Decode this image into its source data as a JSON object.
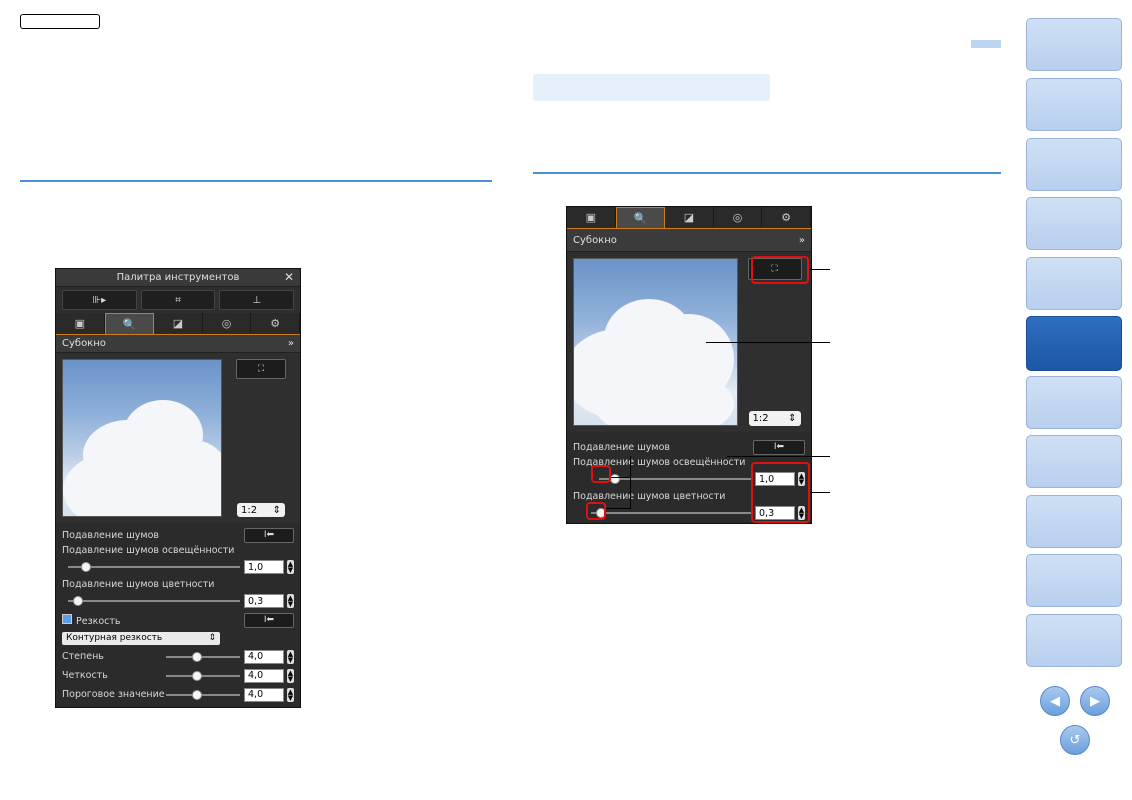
{
  "left_panel": {
    "title": "Палитра инструментов",
    "close_glyph": "✕",
    "tool_buttons": [
      "⊪▸",
      "⌗",
      "⊥"
    ],
    "tabs": [
      "▣",
      "🔍",
      "◪",
      "◎",
      "⚙"
    ],
    "section_title": "Субокно",
    "collapse_glyph": "»",
    "zoom_value": "1:2",
    "noise_heading": "Подавление шумов",
    "reset_glyph": "I⬅",
    "luma_label": "Подавление шумов освещённости",
    "luma_value": "1,0",
    "luma_fraction": 0.08,
    "chroma_label": "Подавление шумов цветности",
    "chroma_value": "0,3",
    "chroma_fraction": 0.03,
    "sharpness_label": "Резкость",
    "sharpness_mode": "Контурная резкость",
    "strength_label": "Степень",
    "strength_value": "4,0",
    "fineness_label": "Четкость",
    "fineness_value": "4,0",
    "threshold_label": "Пороговое значение",
    "threshold_value": "4,0",
    "slider_fraction_sharp": 0.4
  },
  "right_panel": {
    "tabs": [
      "▣",
      "🔍",
      "◪",
      "◎",
      "⚙"
    ],
    "section_title": "Субокно",
    "collapse_glyph": "»",
    "zoom_value": "1:2",
    "noise_heading": "Подавление шумов",
    "reset_glyph": "I⬅",
    "luma_label": "Подавление шумов освещённости",
    "luma_value": "1,0",
    "luma_fraction": 0.08,
    "chroma_label": "Подавление шумов цветности",
    "chroma_value": "0,3",
    "chroma_fraction": 0.03
  },
  "icons": {
    "fit": "⛶",
    "prev": "◀",
    "next": "▶",
    "back": "↺"
  },
  "colors": {
    "accent_blue": "#4a90d9",
    "nav_active": "#1c56a6",
    "highlight_red": "#e01010",
    "tab_orange": "#d07a1e"
  }
}
